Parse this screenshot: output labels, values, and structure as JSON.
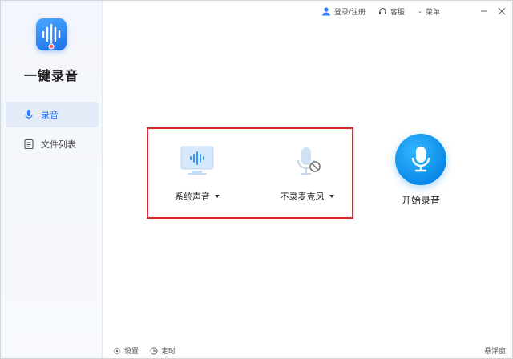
{
  "app": {
    "name": "一键录音"
  },
  "header": {
    "login_label": "登录/注册",
    "service_label": "客服",
    "menu_label": "菜单"
  },
  "sidebar": {
    "items": [
      {
        "label": "录音",
        "icon": "microphone-icon",
        "active": true
      },
      {
        "label": "文件列表",
        "icon": "file-list-icon",
        "active": false
      }
    ]
  },
  "options": {
    "system_sound_label": "系统声音",
    "microphone_label": "不录麦克风"
  },
  "start": {
    "label": "开始录音"
  },
  "footer": {
    "settings_label": "设置",
    "timer_label": "定时",
    "float_window_label": "悬浮窗"
  },
  "colors": {
    "accent": "#2e7cf6",
    "start_button": "#0a8ae8",
    "highlight_border": "#d72a2a"
  }
}
